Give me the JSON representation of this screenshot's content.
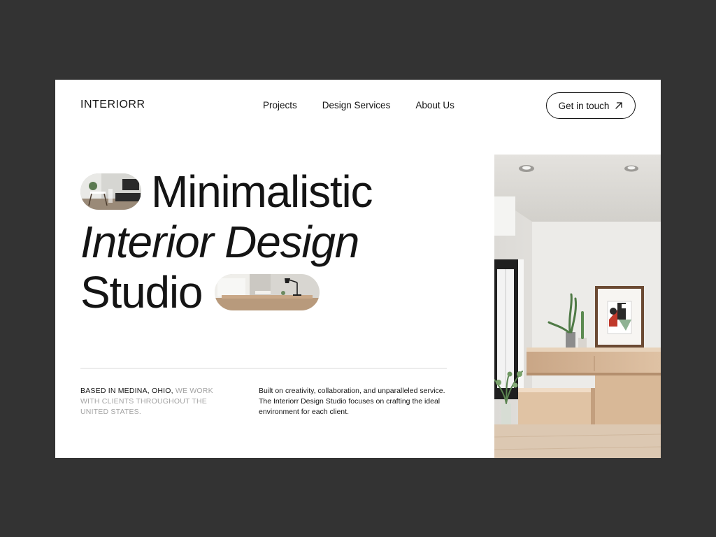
{
  "brand": {
    "name": "INTERIORR"
  },
  "nav": {
    "items": [
      {
        "label": "Projects"
      },
      {
        "label": "Design Services"
      },
      {
        "label": "About Us"
      }
    ]
  },
  "cta": {
    "label": "Get in touch",
    "icon": "arrow-up-right-icon"
  },
  "hero": {
    "line1": "Minimalistic",
    "line2": "Interior Design",
    "line3": "Studio"
  },
  "info": {
    "location_dark": "BASED IN MEDINA, OHIO,",
    "location_muted": "WE WORK WITH CLIENTS THROUGHOUT THE UNITED STATES.",
    "description": "Built on creativity, collaboration, and unparalleled service. The Interiorr Design Studio focuses on crafting the ideal environment for each client."
  },
  "colors": {
    "page_background": "#333333",
    "card_background": "#ffffff",
    "text": "#141414",
    "muted_text": "#a3a3a3",
    "wood": "#d9b896"
  }
}
